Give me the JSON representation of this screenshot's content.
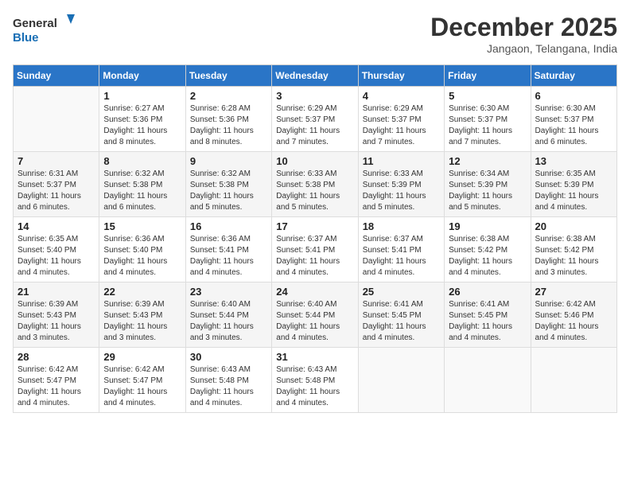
{
  "logo": {
    "line1": "General",
    "line2": "Blue"
  },
  "title": "December 2025",
  "location": "Jangaon, Telangana, India",
  "columns": [
    "Sunday",
    "Monday",
    "Tuesday",
    "Wednesday",
    "Thursday",
    "Friday",
    "Saturday"
  ],
  "weeks": [
    [
      {
        "day": "",
        "empty": true
      },
      {
        "day": "1",
        "sunrise": "6:27 AM",
        "sunset": "5:36 PM",
        "daylight": "11 hours and 8 minutes."
      },
      {
        "day": "2",
        "sunrise": "6:28 AM",
        "sunset": "5:36 PM",
        "daylight": "11 hours and 8 minutes."
      },
      {
        "day": "3",
        "sunrise": "6:29 AM",
        "sunset": "5:37 PM",
        "daylight": "11 hours and 7 minutes."
      },
      {
        "day": "4",
        "sunrise": "6:29 AM",
        "sunset": "5:37 PM",
        "daylight": "11 hours and 7 minutes."
      },
      {
        "day": "5",
        "sunrise": "6:30 AM",
        "sunset": "5:37 PM",
        "daylight": "11 hours and 7 minutes."
      },
      {
        "day": "6",
        "sunrise": "6:30 AM",
        "sunset": "5:37 PM",
        "daylight": "11 hours and 6 minutes."
      }
    ],
    [
      {
        "day": "7",
        "sunrise": "6:31 AM",
        "sunset": "5:37 PM",
        "daylight": "11 hours and 6 minutes."
      },
      {
        "day": "8",
        "sunrise": "6:32 AM",
        "sunset": "5:38 PM",
        "daylight": "11 hours and 6 minutes."
      },
      {
        "day": "9",
        "sunrise": "6:32 AM",
        "sunset": "5:38 PM",
        "daylight": "11 hours and 5 minutes."
      },
      {
        "day": "10",
        "sunrise": "6:33 AM",
        "sunset": "5:38 PM",
        "daylight": "11 hours and 5 minutes."
      },
      {
        "day": "11",
        "sunrise": "6:33 AM",
        "sunset": "5:39 PM",
        "daylight": "11 hours and 5 minutes."
      },
      {
        "day": "12",
        "sunrise": "6:34 AM",
        "sunset": "5:39 PM",
        "daylight": "11 hours and 5 minutes."
      },
      {
        "day": "13",
        "sunrise": "6:35 AM",
        "sunset": "5:39 PM",
        "daylight": "11 hours and 4 minutes."
      }
    ],
    [
      {
        "day": "14",
        "sunrise": "6:35 AM",
        "sunset": "5:40 PM",
        "daylight": "11 hours and 4 minutes."
      },
      {
        "day": "15",
        "sunrise": "6:36 AM",
        "sunset": "5:40 PM",
        "daylight": "11 hours and 4 minutes."
      },
      {
        "day": "16",
        "sunrise": "6:36 AM",
        "sunset": "5:41 PM",
        "daylight": "11 hours and 4 minutes."
      },
      {
        "day": "17",
        "sunrise": "6:37 AM",
        "sunset": "5:41 PM",
        "daylight": "11 hours and 4 minutes."
      },
      {
        "day": "18",
        "sunrise": "6:37 AM",
        "sunset": "5:41 PM",
        "daylight": "11 hours and 4 minutes."
      },
      {
        "day": "19",
        "sunrise": "6:38 AM",
        "sunset": "5:42 PM",
        "daylight": "11 hours and 4 minutes."
      },
      {
        "day": "20",
        "sunrise": "6:38 AM",
        "sunset": "5:42 PM",
        "daylight": "11 hours and 3 minutes."
      }
    ],
    [
      {
        "day": "21",
        "sunrise": "6:39 AM",
        "sunset": "5:43 PM",
        "daylight": "11 hours and 3 minutes."
      },
      {
        "day": "22",
        "sunrise": "6:39 AM",
        "sunset": "5:43 PM",
        "daylight": "11 hours and 3 minutes."
      },
      {
        "day": "23",
        "sunrise": "6:40 AM",
        "sunset": "5:44 PM",
        "daylight": "11 hours and 3 minutes."
      },
      {
        "day": "24",
        "sunrise": "6:40 AM",
        "sunset": "5:44 PM",
        "daylight": "11 hours and 4 minutes."
      },
      {
        "day": "25",
        "sunrise": "6:41 AM",
        "sunset": "5:45 PM",
        "daylight": "11 hours and 4 minutes."
      },
      {
        "day": "26",
        "sunrise": "6:41 AM",
        "sunset": "5:45 PM",
        "daylight": "11 hours and 4 minutes."
      },
      {
        "day": "27",
        "sunrise": "6:42 AM",
        "sunset": "5:46 PM",
        "daylight": "11 hours and 4 minutes."
      }
    ],
    [
      {
        "day": "28",
        "sunrise": "6:42 AM",
        "sunset": "5:47 PM",
        "daylight": "11 hours and 4 minutes."
      },
      {
        "day": "29",
        "sunrise": "6:42 AM",
        "sunset": "5:47 PM",
        "daylight": "11 hours and 4 minutes."
      },
      {
        "day": "30",
        "sunrise": "6:43 AM",
        "sunset": "5:48 PM",
        "daylight": "11 hours and 4 minutes."
      },
      {
        "day": "31",
        "sunrise": "6:43 AM",
        "sunset": "5:48 PM",
        "daylight": "11 hours and 4 minutes."
      },
      {
        "day": "",
        "empty": true
      },
      {
        "day": "",
        "empty": true
      },
      {
        "day": "",
        "empty": true
      }
    ]
  ]
}
